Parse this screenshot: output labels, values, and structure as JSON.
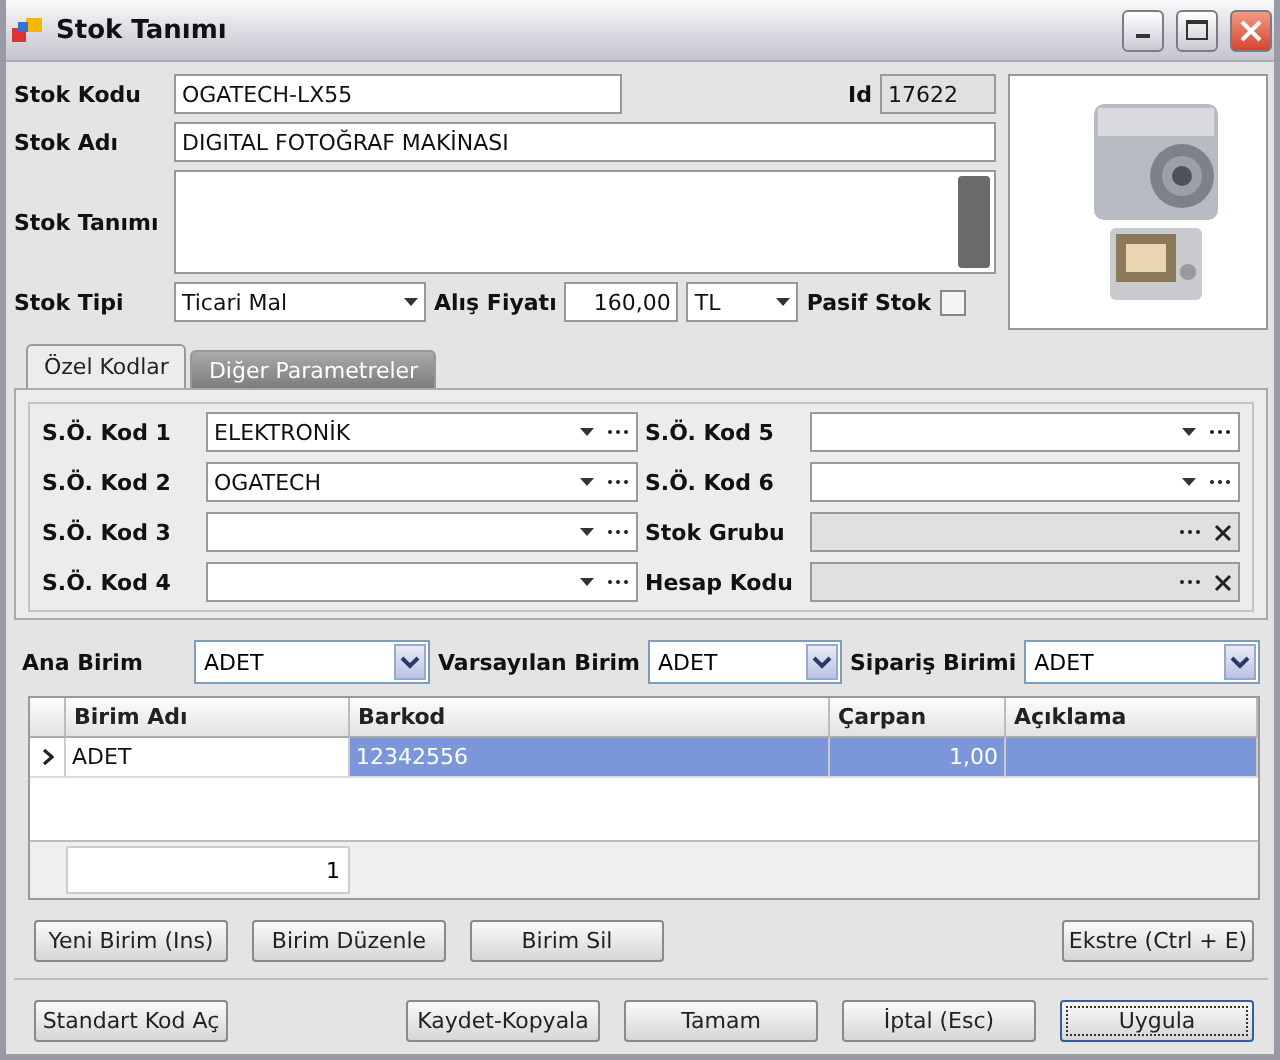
{
  "window": {
    "title": "Stok Tanımı"
  },
  "header": {
    "stok_kodu": {
      "label": "Stok Kodu",
      "value": "OGATECH-LX55"
    },
    "id": {
      "label": "Id",
      "value": "17622"
    },
    "stok_adi": {
      "label": "Stok Adı",
      "value": "DIGITAL FOTOĞRAF MAKİNASI"
    },
    "stok_tanimi": {
      "label": "Stok Tanımı"
    },
    "stok_tipi": {
      "label": "Stok Tipi",
      "value": "Ticari Mal"
    },
    "alis_fiyati": {
      "label": "Alış Fiyatı",
      "value": "160,00",
      "currency": "TL"
    },
    "pasif_stok": {
      "label": "Pasif Stok",
      "checked": false
    }
  },
  "tabs": [
    {
      "label": "Özel Kodlar",
      "selected": true
    },
    {
      "label": "Diğer Parametreler",
      "selected": false
    }
  ],
  "codes": [
    {
      "label": "S.Ö. Kod 1",
      "value": "ELEKTRONİK",
      "kind": "combo"
    },
    {
      "label": "S.Ö. Kod 5",
      "kind": "combo"
    },
    {
      "label": "S.Ö. Kod 2",
      "value": "OGATECH",
      "kind": "combo"
    },
    {
      "label": "S.Ö. Kod 6",
      "kind": "combo"
    },
    {
      "label": "S.Ö. Kod 3",
      "kind": "combo"
    },
    {
      "label": "Stok Grubu",
      "kind": "lookup"
    },
    {
      "label": "S.Ö. Kod 4",
      "kind": "combo"
    },
    {
      "label": "Hesap Kodu",
      "kind": "lookup"
    }
  ],
  "units": [
    {
      "label": "Ana Birim",
      "value": "ADET"
    },
    {
      "label": "Varsayılan Birim",
      "value": "ADET"
    },
    {
      "label": "Sipariş Birimi",
      "value": "ADET"
    }
  ],
  "table": {
    "columns": [
      "Birim Adı",
      "Barkod",
      "Çarpan",
      "Açıklama"
    ],
    "rows": [
      {
        "cells": [
          "ADET",
          "12342556",
          "1,00",
          ""
        ],
        "selected": true
      }
    ],
    "footer": "1"
  },
  "grid_buttons": [
    "Yeni Birim (Ins)",
    "Birim Düzenle",
    "Birim Sil",
    "Ekstre (Ctrl + E)"
  ],
  "bottom_buttons": [
    {
      "label": "Standart Kod Aç",
      "default": false
    },
    {
      "label": "Kaydet-Kopyala",
      "default": false
    },
    {
      "label": "Tamam",
      "default": false
    },
    {
      "label": "İptal (Esc)",
      "default": false
    },
    {
      "label": "Uygula",
      "default": true
    }
  ]
}
